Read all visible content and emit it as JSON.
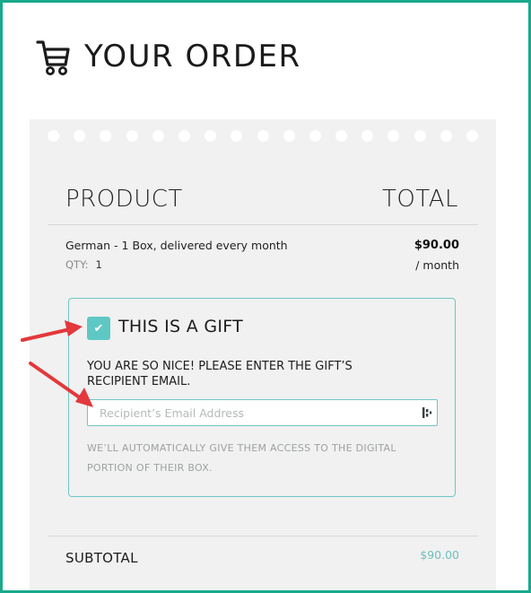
{
  "header": {
    "title": "YOUR ORDER",
    "icon": "cart-icon"
  },
  "order": {
    "columns": {
      "product": "PRODUCT",
      "total": "TOTAL"
    },
    "item": {
      "name": "German - 1 Box, delivered every month",
      "qty_label": "QTY:",
      "qty_value": "1",
      "price": "$90.00",
      "period": "/ month"
    },
    "gift": {
      "checked": true,
      "label": "THIS IS A GIFT",
      "prompt": "YOU ARE SO NICE! PLEASE ENTER THE GIFT’S RECIPIENT EMAIL.",
      "email_placeholder": "Recipient’s Email Address",
      "email_value": "",
      "note": "WE’LL AUTOMATICALLY GIVE THEM ACCESS TO THE DIGITAL PORTION OF THEIR BOX."
    },
    "subtotal": {
      "label": "SUBTOTAL",
      "value": "$90.00"
    }
  },
  "colors": {
    "frame": "#19a98c",
    "accent": "#5ec8c4",
    "annotation_arrow": "#e3383c",
    "receipt_bg": "#f0f1f0"
  }
}
